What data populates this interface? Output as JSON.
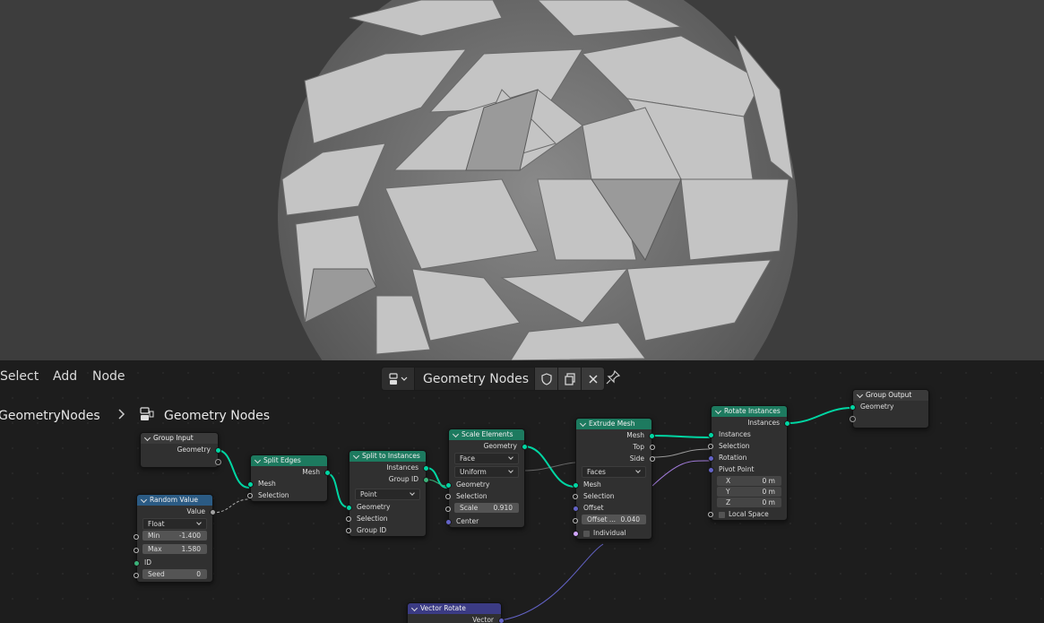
{
  "header": {
    "menus": [
      "Select",
      "Add",
      "Node"
    ],
    "node_group_name": "Geometry Nodes",
    "breadcrumb": {
      "parent": "GeometryNodes",
      "child": "Geometry Nodes"
    }
  },
  "nodes": {
    "group_input": {
      "title": "Group Input",
      "outputs": [
        "Geometry"
      ]
    },
    "random_value": {
      "title": "Random Value",
      "output": "Value",
      "type": "Float",
      "min_label": "Min",
      "min": "-1.400",
      "max_label": "Max",
      "max": "1.580",
      "id_label": "ID",
      "seed_label": "Seed",
      "seed": "0"
    },
    "split_edges": {
      "title": "Split Edges",
      "output": "Mesh",
      "inputs": [
        "Mesh",
        "Selection"
      ]
    },
    "split_to_instances": {
      "title": "Split to Instances",
      "outputs": [
        "Instances",
        "Group ID"
      ],
      "domain": "Point",
      "inputs": [
        "Geometry",
        "Selection",
        "Group ID"
      ]
    },
    "scale_elements": {
      "title": "Scale Elements",
      "output": "Geometry",
      "domain": "Face",
      "mode": "Uniform",
      "inputs": [
        "Geometry",
        "Selection"
      ],
      "scale_label": "Scale",
      "scale": "0.910",
      "center_label": "Center"
    },
    "extrude_mesh": {
      "title": "Extrude Mesh",
      "outputs": [
        "Mesh",
        "Top",
        "Side"
      ],
      "mode": "Faces",
      "inputs": [
        "Mesh",
        "Selection",
        "Offset"
      ],
      "offset_scale_label": "Offset ...",
      "offset_scale": "0.040",
      "individual_label": "Individual"
    },
    "rotate_instances": {
      "title": "Rotate Instances",
      "output": "Instances",
      "inputs": [
        "Instances",
        "Selection",
        "Rotation",
        "Pivot Point"
      ],
      "pivot": [
        {
          "axis": "X",
          "value": "0 m"
        },
        {
          "axis": "Y",
          "value": "0 m"
        },
        {
          "axis": "Z",
          "value": "0 m"
        }
      ],
      "local_space_label": "Local Space"
    },
    "group_output": {
      "title": "Group Output",
      "inputs": [
        "Geometry"
      ]
    },
    "vector_rotate": {
      "title": "Vector Rotate",
      "output": "Vector"
    }
  },
  "colors": {
    "geometry_header": "#1d7a5f",
    "utility_header": "#2b5b84",
    "vector_header": "#3b3b84",
    "geometry_link": "#00d6a3",
    "vector_link": "#6363c7",
    "viewport_bg": "#3d3d3d",
    "editor_bg": "#1d1d1d"
  }
}
